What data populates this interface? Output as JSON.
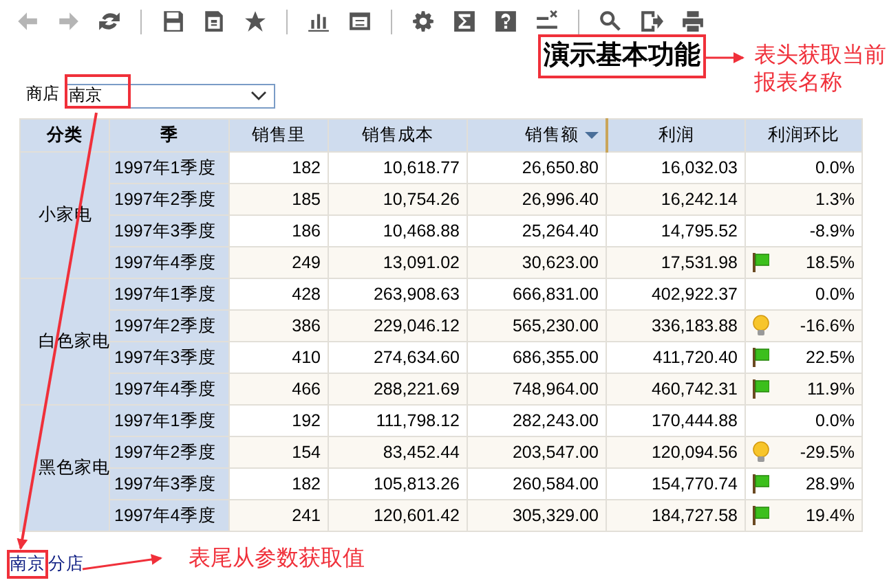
{
  "toolbar": [
    {
      "kind": "back",
      "disabled": true
    },
    {
      "kind": "forward",
      "disabled": true
    },
    {
      "kind": "refresh",
      "disabled": false
    },
    {
      "kind": "separator"
    },
    {
      "kind": "save",
      "disabled": false
    },
    {
      "kind": "export",
      "disabled": false
    },
    {
      "kind": "favorite",
      "disabled": false
    },
    {
      "kind": "separator"
    },
    {
      "kind": "chart",
      "disabled": false
    },
    {
      "kind": "layout",
      "disabled": false
    },
    {
      "kind": "separator"
    },
    {
      "kind": "settings",
      "disabled": false
    },
    {
      "kind": "sum",
      "disabled": false
    },
    {
      "kind": "help",
      "disabled": false
    },
    {
      "kind": "clear",
      "disabled": false
    },
    {
      "kind": "separator"
    },
    {
      "kind": "search",
      "disabled": false
    },
    {
      "kind": "exit",
      "disabled": false
    },
    {
      "kind": "print",
      "disabled": false
    }
  ],
  "report": {
    "title": "演示基本功能",
    "parameter": {
      "label": "商店",
      "value": "南京"
    },
    "table": {
      "columns": [
        {
          "label": "分类",
          "bold": true,
          "sorted": false
        },
        {
          "label": "季",
          "bold": true,
          "sorted": false
        },
        {
          "label": "销售里",
          "bold": false,
          "sorted": false
        },
        {
          "label": "销售成本",
          "bold": false,
          "sorted": false
        },
        {
          "label": "销售额",
          "bold": false,
          "sorted": true
        },
        {
          "label": "利润",
          "bold": false,
          "sorted": false
        },
        {
          "label": "利润环比",
          "bold": false,
          "sorted": false
        }
      ],
      "groups": [
        {
          "category": "小家电",
          "rows": [
            {
              "quarter": "1997年1季度",
              "qty": "182",
              "cost": "10,618.77",
              "sales": "26,650.80",
              "profit": "16,032.03",
              "kind": "plain",
              "ratio": "0.0%"
            },
            {
              "quarter": "1997年2季度",
              "qty": "185",
              "cost": "10,754.26",
              "sales": "26,996.40",
              "profit": "16,242.14",
              "kind": "plain",
              "ratio": "1.3%"
            },
            {
              "quarter": "1997年3季度",
              "qty": "186",
              "cost": "10,468.88",
              "sales": "25,264.40",
              "profit": "14,795.52",
              "kind": "plain",
              "ratio": "-8.9%"
            },
            {
              "quarter": "1997年4季度",
              "qty": "249",
              "cost": "13,091.02",
              "sales": "30,623.00",
              "profit": "17,531.98",
              "kind": "flag",
              "ratio": "18.5%"
            }
          ]
        },
        {
          "category": "白色家电",
          "rows": [
            {
              "quarter": "1997年1季度",
              "qty": "428",
              "cost": "263,908.63",
              "sales": "666,831.00",
              "profit": "402,922.37",
              "kind": "plain",
              "ratio": "0.0%"
            },
            {
              "quarter": "1997年2季度",
              "qty": "386",
              "cost": "229,046.12",
              "sales": "565,230.00",
              "profit": "336,183.88",
              "kind": "bulb",
              "ratio": "-16.6%"
            },
            {
              "quarter": "1997年3季度",
              "qty": "410",
              "cost": "274,634.60",
              "sales": "686,355.00",
              "profit": "411,720.40",
              "kind": "flag",
              "ratio": "22.5%"
            },
            {
              "quarter": "1997年4季度",
              "qty": "466",
              "cost": "288,221.69",
              "sales": "748,964.00",
              "profit": "460,742.31",
              "kind": "flag",
              "ratio": "11.9%"
            }
          ]
        },
        {
          "category": "黑色家电",
          "rows": [
            {
              "quarter": "1997年1季度",
              "qty": "192",
              "cost": "111,798.12",
              "sales": "282,243.00",
              "profit": "170,444.88",
              "kind": "plain",
              "ratio": "0.0%"
            },
            {
              "quarter": "1997年2季度",
              "qty": "154",
              "cost": "83,452.44",
              "sales": "203,547.00",
              "profit": "120,094.56",
              "kind": "bulb",
              "ratio": "-29.5%"
            },
            {
              "quarter": "1997年3季度",
              "qty": "182",
              "cost": "105,813.26",
              "sales": "260,584.00",
              "profit": "154,770.74",
              "kind": "flag",
              "ratio": "28.9%"
            },
            {
              "quarter": "1997年4季度",
              "qty": "241",
              "cost": "120,601.42",
              "sales": "305,329.00",
              "profit": "184,727.58",
              "kind": "flag",
              "ratio": "19.4%"
            }
          ]
        }
      ]
    },
    "footer": "南京分店"
  },
  "annotations": [
    {
      "kind": "header",
      "text": "表头获取当前报表名称"
    },
    {
      "kind": "footer",
      "text": "表尾从参数获取值"
    }
  ]
}
